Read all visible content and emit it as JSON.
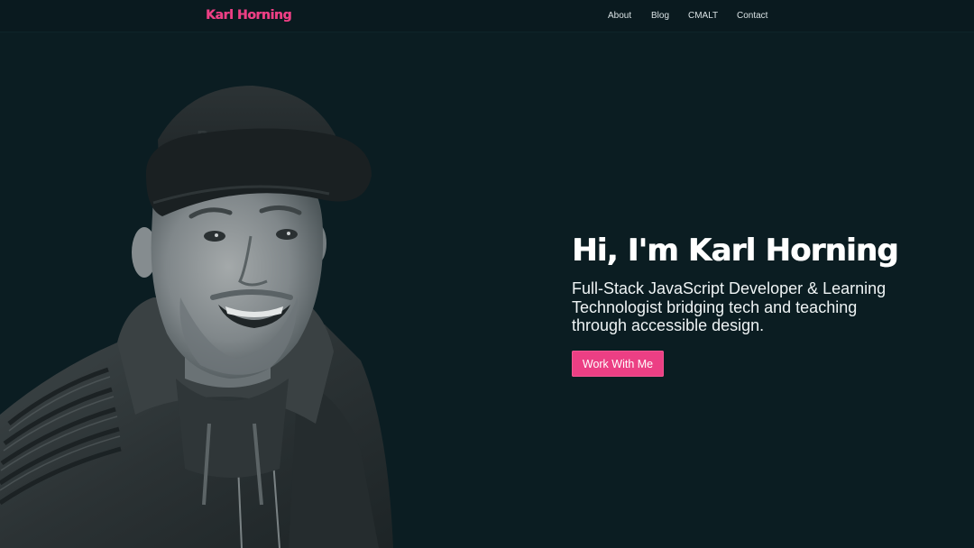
{
  "header": {
    "logo_text": "Karl Horning",
    "nav": [
      {
        "label": "About"
      },
      {
        "label": "Blog"
      },
      {
        "label": "CMALT"
      },
      {
        "label": "Contact"
      }
    ]
  },
  "hero": {
    "title": "Hi, I'm Karl Horning",
    "subtitle": "Full-Stack JavaScript Developer & Learning Technologist bridging tech and teaching through accessible design.",
    "cta_label": "Work With Me"
  },
  "colors": {
    "background": "#0b1d22",
    "accent": "#ec3f84",
    "text": "#ffffff"
  }
}
